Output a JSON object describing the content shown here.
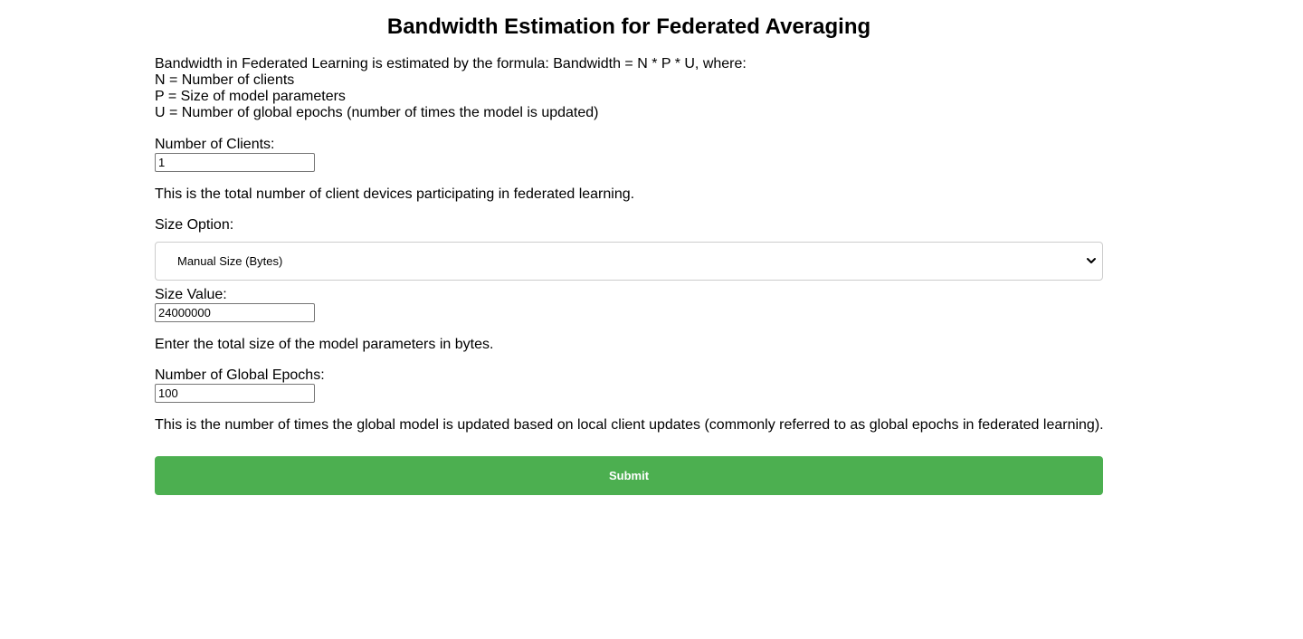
{
  "title": "Bandwidth Estimation for Federated Averaging",
  "intro": {
    "formula_line": "Bandwidth in Federated Learning is estimated by the formula: Bandwidth = N * P * U, where:",
    "n_line": "N = Number of clients",
    "p_line": "P = Size of model parameters",
    "u_line": "U = Number of global epochs (number of times the model is updated)"
  },
  "clients": {
    "label": "Number of Clients:",
    "value": "1",
    "help": "This is the total number of client devices participating in federated learning."
  },
  "size_option": {
    "label": "Size Option:",
    "selected": "Manual Size (Bytes)"
  },
  "size_value": {
    "label": "Size Value:",
    "value": "24000000",
    "help": "Enter the total size of the model parameters in bytes."
  },
  "epochs": {
    "label": "Number of Global Epochs:",
    "value": "100",
    "help": "This is the number of times the global model is updated based on local client updates (commonly referred to as global epochs in federated learning)."
  },
  "submit": {
    "label": "Submit",
    "color": "#4caf50"
  }
}
